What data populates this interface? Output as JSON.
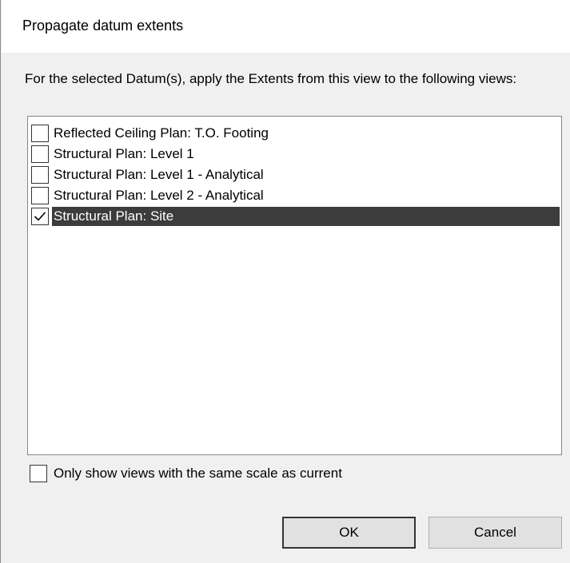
{
  "dialog": {
    "title": "Propagate datum extents",
    "instructions": "For the selected Datum(s), apply the Extents from this view to the following views:",
    "views": [
      {
        "label": "Reflected Ceiling Plan: T.O. Footing",
        "checked": false,
        "selected": false
      },
      {
        "label": "Structural Plan: Level 1",
        "checked": false,
        "selected": false
      },
      {
        "label": "Structural Plan: Level 1 - Analytical",
        "checked": false,
        "selected": false
      },
      {
        "label": "Structural Plan: Level 2 - Analytical",
        "checked": false,
        "selected": false
      },
      {
        "label": "Structural Plan: Site",
        "checked": true,
        "selected": true
      }
    ],
    "scale_filter": {
      "label": "Only show views with the same scale as current",
      "checked": false
    },
    "ok_label": "OK",
    "cancel_label": "Cancel"
  }
}
